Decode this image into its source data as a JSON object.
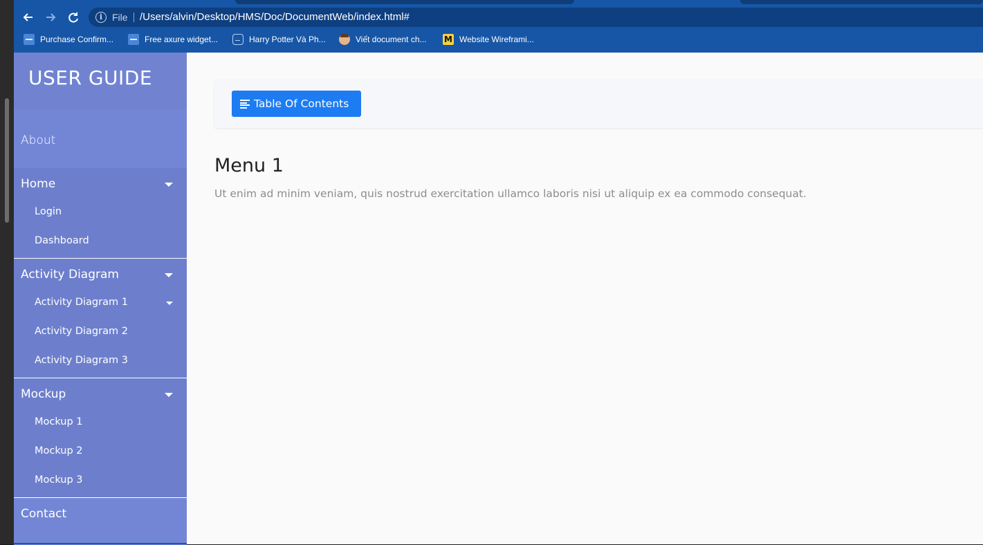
{
  "browser": {
    "back_icon": "arrow-left-icon",
    "forward_icon": "arrow-right-icon",
    "reload_icon": "reload-icon",
    "info_icon": "info-icon",
    "file_label": "File",
    "url": "/Users/alvin/Desktop/HMS/Doc/DocumentWeb/index.html#",
    "bookmarks": [
      {
        "label": "Purchase Confirm...",
        "icon": "axure-icon"
      },
      {
        "label": "Free axure widget...",
        "icon": "axure-icon"
      },
      {
        "label": "Harry Potter Và Ph...",
        "icon": "robot-icon"
      },
      {
        "label": "Viết document ch...",
        "icon": "avatar-icon"
      },
      {
        "label": "Website Wireframi...",
        "icon": "miro-icon"
      }
    ]
  },
  "sidebar": {
    "brand": "USER GUIDE",
    "about": "About",
    "groups": [
      {
        "label": "Home",
        "items": [
          "Login",
          "Dashboard"
        ]
      },
      {
        "label": "Activity Diagram",
        "items": [
          "Activity Diagram 1",
          "Activity Diagram 2",
          "Activity Diagram 3"
        ]
      },
      {
        "label": "Mockup",
        "items": [
          "Mockup 1",
          "Mockup 2",
          "Mockup 3"
        ]
      }
    ],
    "contact": "Contact"
  },
  "main": {
    "toc_button": "Table Of Contents",
    "title": "Menu 1",
    "text": "Ut enim ad minim veniam, quis nostrud exercitation ullamco laboris nisi ut aliquip ex ea commodo consequat."
  }
}
